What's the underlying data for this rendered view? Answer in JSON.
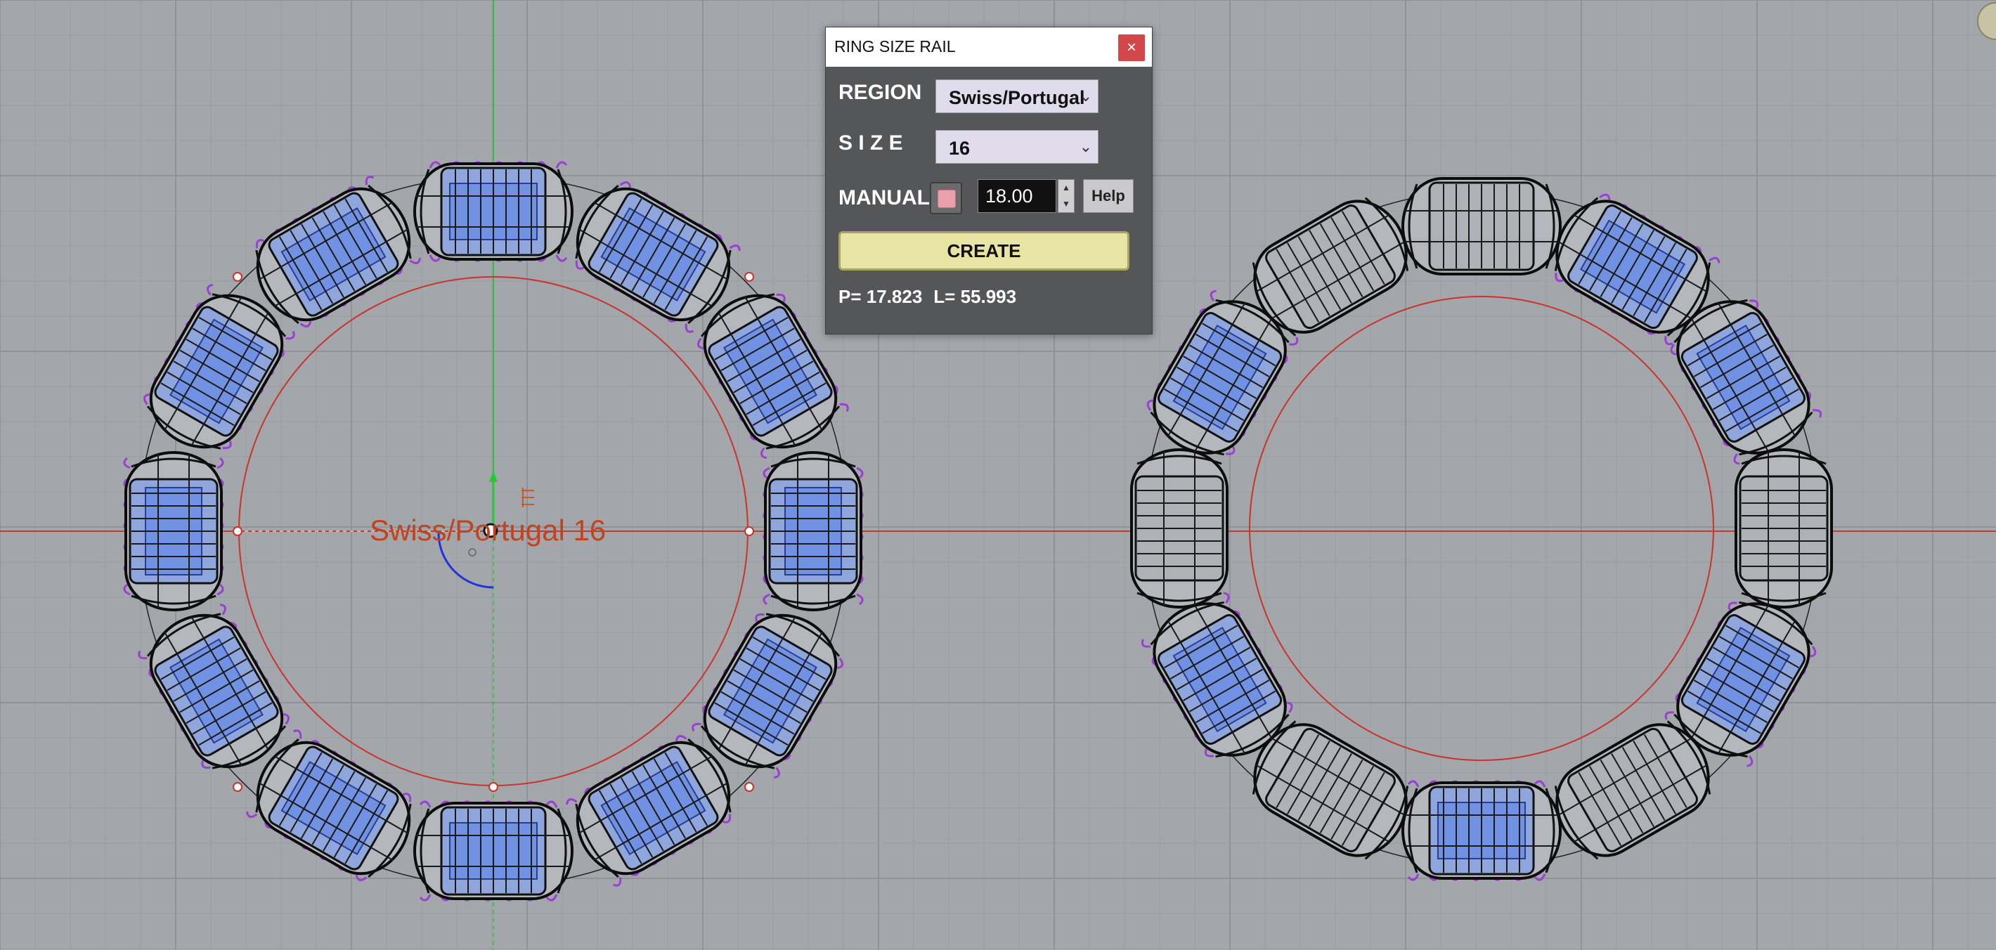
{
  "dialog": {
    "title": "RING SIZE RAIL",
    "close_glyph": "×",
    "region_label": "REGION",
    "region_value": "Swiss/Portugal",
    "size_label": "S I Z E",
    "size_value": "16",
    "manual_label": "MANUAL",
    "manual_value": "18.00",
    "help_label": "Help",
    "create_label": "CREATE",
    "perimeter": "P= 17.823",
    "length": "L= 55.993"
  },
  "viewport": {
    "annotation": "Swiss/Portugal 16",
    "annotation_color": "#c0441f"
  },
  "colors": {
    "background": "#a3a6ab",
    "grid": "#999ca1",
    "x_axis": "#c33b2b",
    "y_axis": "#2fbf3a",
    "ring_rail": "#c9342b",
    "dialog_bg": "#555658",
    "create_bg": "#e8e5a4",
    "gem_blue": "#5a82e6",
    "prong_purple": "#9a3fd1"
  },
  "icons": {
    "close": "close-icon",
    "dropdown": "chevron-down-icon",
    "spin": "spin-arrows-icon"
  }
}
